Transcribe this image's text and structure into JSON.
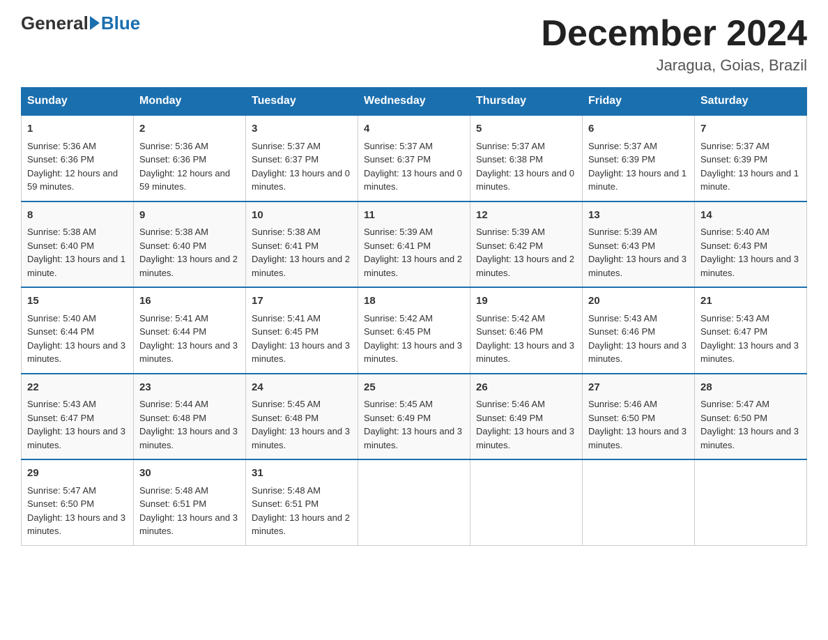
{
  "header": {
    "logo_general": "General",
    "logo_blue": "Blue",
    "month_title": "December 2024",
    "location": "Jaragua, Goias, Brazil"
  },
  "days_of_week": [
    "Sunday",
    "Monday",
    "Tuesday",
    "Wednesday",
    "Thursday",
    "Friday",
    "Saturday"
  ],
  "weeks": [
    [
      {
        "day": "1",
        "sunrise": "5:36 AM",
        "sunset": "6:36 PM",
        "daylight": "12 hours and 59 minutes."
      },
      {
        "day": "2",
        "sunrise": "5:36 AM",
        "sunset": "6:36 PM",
        "daylight": "12 hours and 59 minutes."
      },
      {
        "day": "3",
        "sunrise": "5:37 AM",
        "sunset": "6:37 PM",
        "daylight": "13 hours and 0 minutes."
      },
      {
        "day": "4",
        "sunrise": "5:37 AM",
        "sunset": "6:37 PM",
        "daylight": "13 hours and 0 minutes."
      },
      {
        "day": "5",
        "sunrise": "5:37 AM",
        "sunset": "6:38 PM",
        "daylight": "13 hours and 0 minutes."
      },
      {
        "day": "6",
        "sunrise": "5:37 AM",
        "sunset": "6:39 PM",
        "daylight": "13 hours and 1 minute."
      },
      {
        "day": "7",
        "sunrise": "5:37 AM",
        "sunset": "6:39 PM",
        "daylight": "13 hours and 1 minute."
      }
    ],
    [
      {
        "day": "8",
        "sunrise": "5:38 AM",
        "sunset": "6:40 PM",
        "daylight": "13 hours and 1 minute."
      },
      {
        "day": "9",
        "sunrise": "5:38 AM",
        "sunset": "6:40 PM",
        "daylight": "13 hours and 2 minutes."
      },
      {
        "day": "10",
        "sunrise": "5:38 AM",
        "sunset": "6:41 PM",
        "daylight": "13 hours and 2 minutes."
      },
      {
        "day": "11",
        "sunrise": "5:39 AM",
        "sunset": "6:41 PM",
        "daylight": "13 hours and 2 minutes."
      },
      {
        "day": "12",
        "sunrise": "5:39 AM",
        "sunset": "6:42 PM",
        "daylight": "13 hours and 2 minutes."
      },
      {
        "day": "13",
        "sunrise": "5:39 AM",
        "sunset": "6:43 PM",
        "daylight": "13 hours and 3 minutes."
      },
      {
        "day": "14",
        "sunrise": "5:40 AM",
        "sunset": "6:43 PM",
        "daylight": "13 hours and 3 minutes."
      }
    ],
    [
      {
        "day": "15",
        "sunrise": "5:40 AM",
        "sunset": "6:44 PM",
        "daylight": "13 hours and 3 minutes."
      },
      {
        "day": "16",
        "sunrise": "5:41 AM",
        "sunset": "6:44 PM",
        "daylight": "13 hours and 3 minutes."
      },
      {
        "day": "17",
        "sunrise": "5:41 AM",
        "sunset": "6:45 PM",
        "daylight": "13 hours and 3 minutes."
      },
      {
        "day": "18",
        "sunrise": "5:42 AM",
        "sunset": "6:45 PM",
        "daylight": "13 hours and 3 minutes."
      },
      {
        "day": "19",
        "sunrise": "5:42 AM",
        "sunset": "6:46 PM",
        "daylight": "13 hours and 3 minutes."
      },
      {
        "day": "20",
        "sunrise": "5:43 AM",
        "sunset": "6:46 PM",
        "daylight": "13 hours and 3 minutes."
      },
      {
        "day": "21",
        "sunrise": "5:43 AM",
        "sunset": "6:47 PM",
        "daylight": "13 hours and 3 minutes."
      }
    ],
    [
      {
        "day": "22",
        "sunrise": "5:43 AM",
        "sunset": "6:47 PM",
        "daylight": "13 hours and 3 minutes."
      },
      {
        "day": "23",
        "sunrise": "5:44 AM",
        "sunset": "6:48 PM",
        "daylight": "13 hours and 3 minutes."
      },
      {
        "day": "24",
        "sunrise": "5:45 AM",
        "sunset": "6:48 PM",
        "daylight": "13 hours and 3 minutes."
      },
      {
        "day": "25",
        "sunrise": "5:45 AM",
        "sunset": "6:49 PM",
        "daylight": "13 hours and 3 minutes."
      },
      {
        "day": "26",
        "sunrise": "5:46 AM",
        "sunset": "6:49 PM",
        "daylight": "13 hours and 3 minutes."
      },
      {
        "day": "27",
        "sunrise": "5:46 AM",
        "sunset": "6:50 PM",
        "daylight": "13 hours and 3 minutes."
      },
      {
        "day": "28",
        "sunrise": "5:47 AM",
        "sunset": "6:50 PM",
        "daylight": "13 hours and 3 minutes."
      }
    ],
    [
      {
        "day": "29",
        "sunrise": "5:47 AM",
        "sunset": "6:50 PM",
        "daylight": "13 hours and 3 minutes."
      },
      {
        "day": "30",
        "sunrise": "5:48 AM",
        "sunset": "6:51 PM",
        "daylight": "13 hours and 3 minutes."
      },
      {
        "day": "31",
        "sunrise": "5:48 AM",
        "sunset": "6:51 PM",
        "daylight": "13 hours and 2 minutes."
      },
      null,
      null,
      null,
      null
    ]
  ],
  "labels": {
    "sunrise": "Sunrise:",
    "sunset": "Sunset:",
    "daylight": "Daylight:"
  }
}
